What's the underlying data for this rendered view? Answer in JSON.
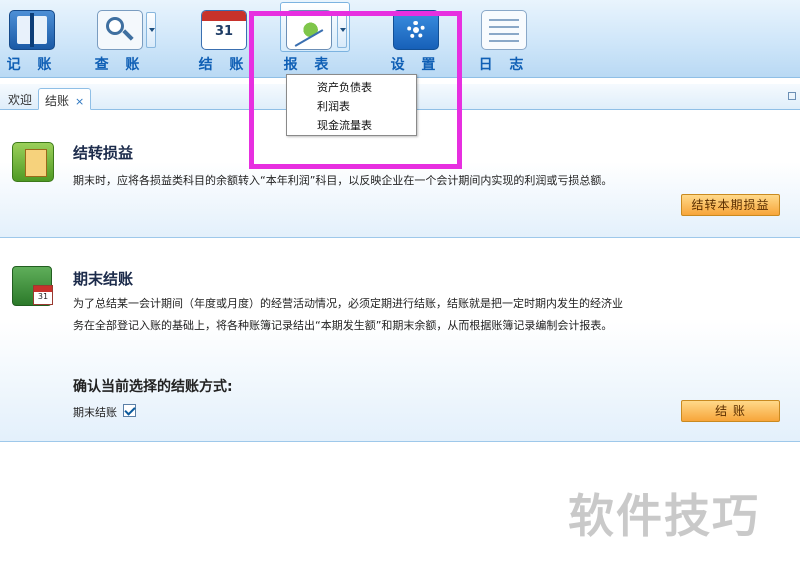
{
  "toolbar": {
    "items": [
      {
        "label": "记 账",
        "icon": "ledger-book-icon"
      },
      {
        "label": "查 账",
        "icon": "magnifier-chart-icon"
      },
      {
        "label": "结 账",
        "icon": "calendar-icon"
      },
      {
        "label": "报 表",
        "icon": "report-chart-icon"
      },
      {
        "label": "设 置",
        "icon": "gear-icon"
      },
      {
        "label": "日 志",
        "icon": "log-list-icon"
      }
    ],
    "calendar_day": "31"
  },
  "tabs": [
    {
      "label": "欢迎"
    },
    {
      "label": "结账",
      "close": "×"
    }
  ],
  "report_menu": {
    "items": [
      "资产负债表",
      "利润表",
      "现金流量表"
    ]
  },
  "section1": {
    "title": "结转损益",
    "description": "期末时，应将各损益类科目的余额转入“本年利润”科目，以反映企业在一个会计期间内实现的利润或亏损总额。",
    "button": "结转本期损益"
  },
  "section2": {
    "title": "期末结账",
    "description_line1": "为了总结某一会计期间（年度或月度）的经营活动情况，必须定期进行结账，结账就是把一定时期内发生的经济业",
    "description_line2": "务在全部登记入账的基础上，将各种账簿记录结出“本期发生额”和期末余额，从而根据账簿记录编制会计报表。",
    "confirm_label": "确认当前选择的结账方式:",
    "checkbox_label": "期末结账",
    "checkbox_checked": true,
    "button": "结 账",
    "calendar_day": "31"
  },
  "watermark": "软件技巧",
  "colors": {
    "highlight": "#e72fe0",
    "button_orange": "#f7a53a",
    "toolbar_label": "#0f5fb5"
  }
}
